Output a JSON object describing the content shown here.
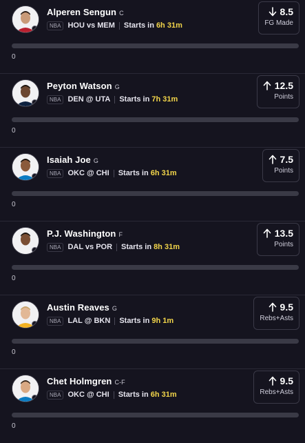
{
  "players": [
    {
      "name": "Alperen Sengun",
      "position": "C",
      "league": "NBA",
      "matchup": "HOU vs MEM",
      "starts_label": "Starts in",
      "time": "6h 31m",
      "direction": "down",
      "value": "8.5",
      "stat": "FG Made",
      "progress": 0,
      "count": "0",
      "avatar": "player-headshot-icon"
    },
    {
      "name": "Peyton Watson",
      "position": "G",
      "league": "NBA",
      "matchup": "DEN @ UTA",
      "starts_label": "Starts in",
      "time": "7h 31m",
      "direction": "up",
      "value": "12.5",
      "stat": "Points",
      "progress": 0,
      "count": "0",
      "avatar": "player-headshot-icon"
    },
    {
      "name": "Isaiah Joe",
      "position": "G",
      "league": "NBA",
      "matchup": "OKC @ CHI",
      "starts_label": "Starts in",
      "time": "6h 31m",
      "direction": "up",
      "value": "7.5",
      "stat": "Points",
      "progress": 0,
      "count": "0",
      "avatar": "player-headshot-icon"
    },
    {
      "name": "P.J. Washington",
      "position": "F",
      "league": "NBA",
      "matchup": "DAL vs POR",
      "starts_label": "Starts in",
      "time": "8h 31m",
      "direction": "up",
      "value": "13.5",
      "stat": "Points",
      "progress": 0,
      "count": "0",
      "avatar": "player-headshot-icon"
    },
    {
      "name": "Austin Reaves",
      "position": "G",
      "league": "NBA",
      "matchup": "LAL @ BKN",
      "starts_label": "Starts in",
      "time": "9h 1m",
      "direction": "up",
      "value": "9.5",
      "stat": "Rebs+Asts",
      "progress": 0,
      "count": "0",
      "avatar": "player-headshot-icon"
    },
    {
      "name": "Chet Holmgren",
      "position": "C-F",
      "league": "NBA",
      "matchup": "OKC @ CHI",
      "starts_label": "Starts in",
      "time": "6h 31m",
      "direction": "up",
      "value": "9.5",
      "stat": "Rebs+Asts",
      "progress": 0,
      "count": "0",
      "avatar": "player-headshot-icon"
    }
  ],
  "colors": {
    "background": "#15141f",
    "highlight_time": "#f2d54a",
    "progress_track": "#3a3a46",
    "card_border": "#3b3a48"
  },
  "avatar_styles": [
    {
      "skin": "#c99a78",
      "jersey": "#b9202f",
      "hair": "#2a1d16"
    },
    {
      "skin": "#6b4630",
      "jersey": "#0e2240",
      "hair": "#1a120c"
    },
    {
      "skin": "#8a5a3b",
      "jersey": "#0a7bc2",
      "hair": "#1a120c"
    },
    {
      "skin": "#7a4e33",
      "jersey": "#f2f2f2",
      "hair": "#1a120c"
    },
    {
      "skin": "#e2b896",
      "jersey": "#f4b323",
      "hair": "#c8a36a"
    },
    {
      "skin": "#d9a983",
      "jersey": "#0a7bc2",
      "hair": "#3a2a1c"
    }
  ]
}
